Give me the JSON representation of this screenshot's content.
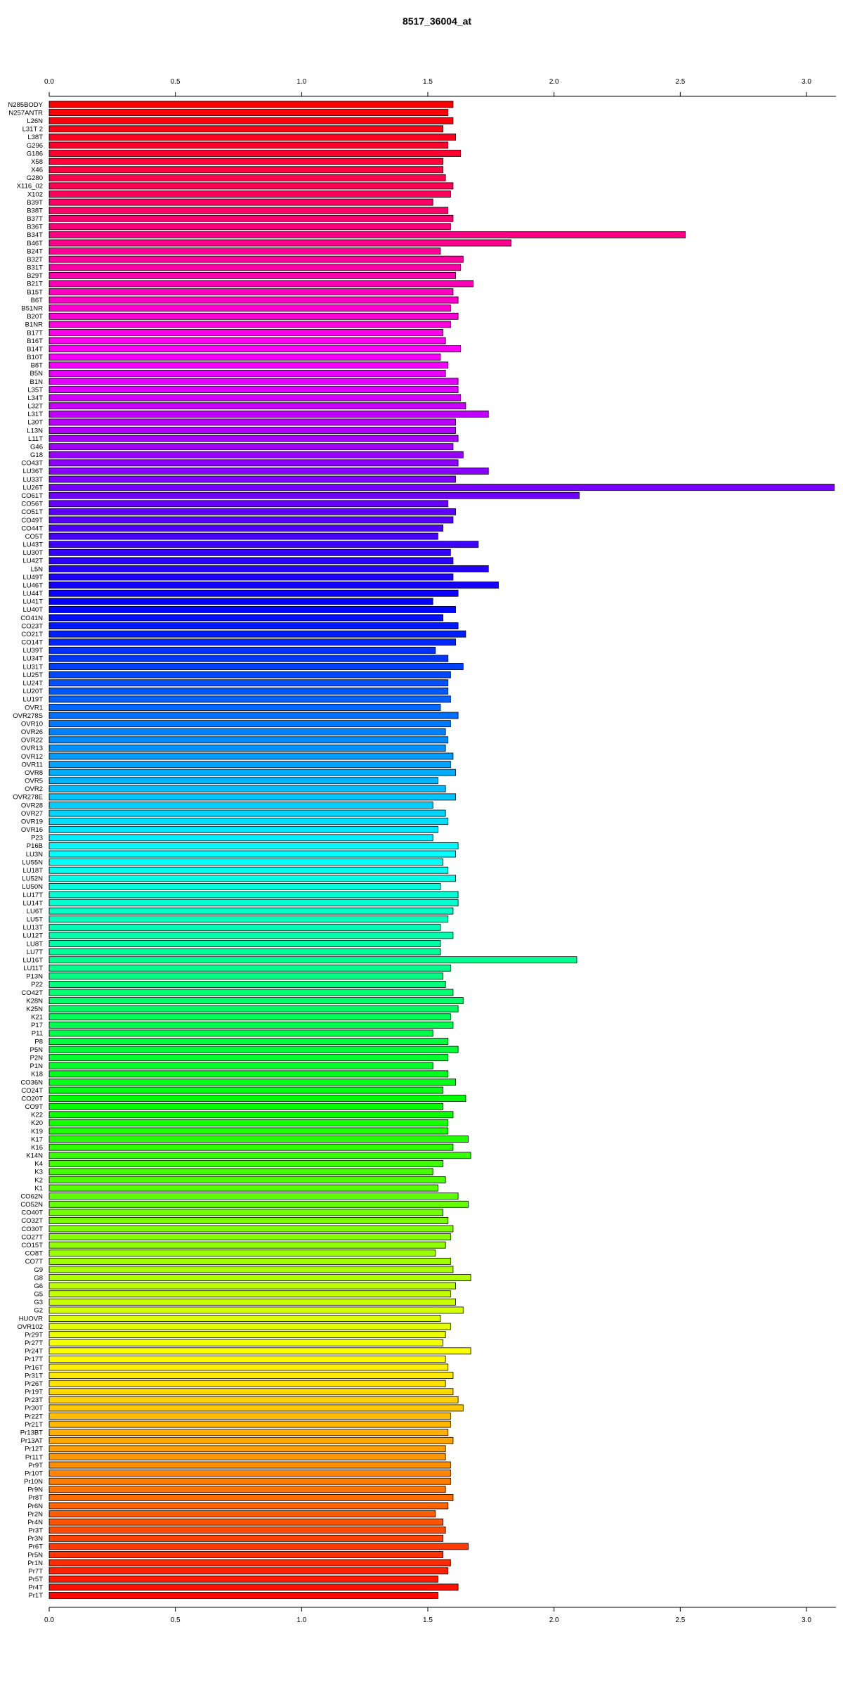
{
  "chart_data": {
    "type": "bar",
    "orientation": "horizontal",
    "title": "8517_36004_at",
    "xlabel": "",
    "ylabel": "",
    "xlim": [
      0,
      3.0
    ],
    "x_ticks": [
      "0.0",
      "0.5",
      "1.0",
      "1.5",
      "2.0",
      "2.5",
      "3.0"
    ],
    "x_tick_values": [
      0,
      0.5,
      1.0,
      1.5,
      2.0,
      2.5,
      3.0
    ],
    "axes": "top and bottom",
    "grid": false,
    "legend": "none",
    "bar_colors": "rainbow gradient: red → magenta → violet → blue → cyan → green → yellow → orange → red",
    "categories": [
      "N285BODY",
      "N257ANTR",
      "L26N",
      "L31T 2",
      "L38T",
      "G296",
      "G186",
      "X58",
      "X46",
      "G280",
      "X116_02",
      "X102",
      "B39T",
      "B38T",
      "B37T",
      "B36T",
      "B34T",
      "B46T",
      "B24T",
      "B32T",
      "B31T",
      "B29T",
      "B21T",
      "B15T",
      "B6T",
      "B51NR",
      "B20T",
      "B1NR",
      "B17T",
      "B16T",
      "B14T",
      "B10T",
      "B8T",
      "B5N",
      "B1N",
      "L35T",
      "L34T",
      "L32T",
      "L31T",
      "L30T",
      "L13N",
      "L11T",
      "G46",
      "G18",
      "CO43T",
      "LU36T",
      "LU33T",
      "LU26T",
      "CO61T",
      "CO56T",
      "CO51T",
      "CO49T",
      "CO44T",
      "CO5T",
      "LU43T",
      "LU30T",
      "LU42T",
      "L5N",
      "LU49T",
      "LU46T",
      "LU44T",
      "LU41T",
      "LU40T",
      "CO41N",
      "CO23T",
      "CO21T",
      "CO14T",
      "LU39T",
      "LU34T",
      "LU31T",
      "LU25T",
      "LU24T",
      "LU20T",
      "LU19T",
      "OVR1",
      "OVR278S",
      "OVR10",
      "OVR26",
      "OVR22",
      "OVR13",
      "OVR12",
      "OVR11",
      "OVR8",
      "OVR5",
      "OVR2",
      "OVR278E",
      "OVR28",
      "OVR27",
      "OVR19",
      "OVR16",
      "P23",
      "P16B",
      "LU3N",
      "LU55N",
      "LU18T",
      "LU52N",
      "LU50N",
      "LU17T",
      "LU14T",
      "LU6T",
      "LU5T",
      "LU13T",
      "LU12T",
      "LU8T",
      "LU7T",
      "LU16T",
      "LU11T",
      "P13N",
      "P22",
      "CO42T",
      "K28N",
      "K25N",
      "K21",
      "P17",
      "P11",
      "P8",
      "P5N",
      "P2N",
      "P1N",
      "K18",
      "CO36N",
      "CO24T",
      "CO20T",
      "CO9T",
      "K22",
      "K20",
      "K19",
      "K17",
      "K16",
      "K14N",
      "K4",
      "K3",
      "K2",
      "K1",
      "CO62N",
      "CO52N",
      "CO40T",
      "CO32T",
      "CO30T",
      "CO27T",
      "CO15T",
      "CO8T",
      "CO7T",
      "G9",
      "G8",
      "G6",
      "G5",
      "G3",
      "G2",
      "HUOVR",
      "OVR102",
      "Pr29T",
      "Pr27T",
      "Pr24T",
      "Pr17T",
      "Pr16T",
      "Pr31T",
      "Pr26T",
      "Pr19T",
      "Pr23T",
      "Pr30T",
      "Pr22T",
      "Pr21T",
      "Pr13BT",
      "Pr13AT",
      "Pr12T",
      "Pr11T",
      "Pr9T",
      "Pr10T",
      "Pr10N",
      "Pr9N",
      "Pr8T",
      "Pr6N",
      "Pr2N",
      "Pr4N",
      "Pr3T",
      "Pr3N",
      "Pr6T",
      "Pr5N",
      "Pr1N",
      "Pr7T",
      "Pr5T",
      "Pr4T",
      "Pr1T"
    ],
    "values": [
      1.6,
      1.58,
      1.6,
      1.56,
      1.61,
      1.58,
      1.63,
      1.56,
      1.56,
      1.57,
      1.6,
      1.59,
      1.52,
      1.58,
      1.6,
      1.59,
      2.52,
      1.83,
      1.55,
      1.64,
      1.63,
      1.61,
      1.68,
      1.6,
      1.62,
      1.59,
      1.62,
      1.59,
      1.56,
      1.57,
      1.63,
      1.55,
      1.58,
      1.57,
      1.62,
      1.62,
      1.63,
      1.65,
      1.74,
      1.61,
      1.61,
      1.62,
      1.6,
      1.64,
      1.62,
      1.74,
      1.61,
      3.11,
      2.1,
      1.58,
      1.61,
      1.6,
      1.56,
      1.54,
      1.7,
      1.59,
      1.6,
      1.74,
      1.6,
      1.78,
      1.62,
      1.52,
      1.61,
      1.56,
      1.62,
      1.65,
      1.61,
      1.53,
      1.58,
      1.64,
      1.59,
      1.58,
      1.58,
      1.59,
      1.55,
      1.62,
      1.59,
      1.57,
      1.58,
      1.57,
      1.6,
      1.59,
      1.61,
      1.54,
      1.57,
      1.61,
      1.52,
      1.57,
      1.58,
      1.54,
      1.52,
      1.62,
      1.61,
      1.56,
      1.58,
      1.61,
      1.55,
      1.62,
      1.62,
      1.6,
      1.58,
      1.55,
      1.6,
      1.55,
      1.55,
      2.09,
      1.59,
      1.56,
      1.57,
      1.6,
      1.64,
      1.62,
      1.59,
      1.6,
      1.52,
      1.58,
      1.62,
      1.58,
      1.52,
      1.58,
      1.61,
      1.56,
      1.65,
      1.56,
      1.6,
      1.58,
      1.58,
      1.66,
      1.6,
      1.67,
      1.56,
      1.52,
      1.57,
      1.54,
      1.62,
      1.66,
      1.56,
      1.58,
      1.6,
      1.59,
      1.57,
      1.53,
      1.59,
      1.6,
      1.67,
      1.61,
      1.59,
      1.61,
      1.64,
      1.55,
      1.59,
      1.57,
      1.56,
      1.67,
      1.57,
      1.58,
      1.6,
      1.57,
      1.6,
      1.62,
      1.64,
      1.59,
      1.59,
      1.58,
      1.6,
      1.57,
      1.57,
      1.59,
      1.59,
      1.59,
      1.57,
      1.6,
      1.58,
      1.53,
      1.56,
      1.57,
      1.56,
      1.66,
      1.56,
      1.59,
      1.58,
      1.54,
      1.62,
      1.54
    ]
  }
}
